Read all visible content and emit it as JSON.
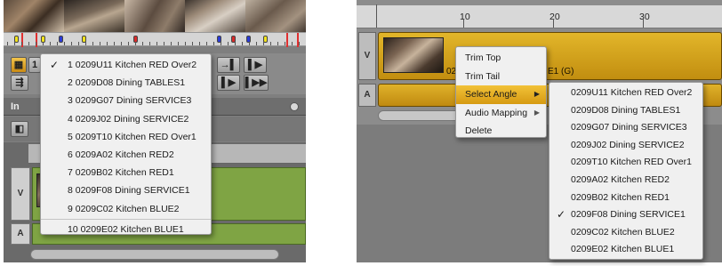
{
  "left_panel": {
    "toolbar": {
      "grid_button": "▦",
      "track_button": "1",
      "forward_button": "→▌",
      "play_in_out_button": "▌▶",
      "step_forward_button": "▌▶",
      "step_forward_fast_button": "▌▶▶",
      "audio_button": "⇶"
    },
    "tab_label": "In",
    "track_labels": {
      "video": "V",
      "audio": "A"
    },
    "angle_menu": {
      "items": [
        {
          "label": "1 0209U11 Kitchen RED Over2",
          "checked": true
        },
        {
          "label": "2 0209D08 Dining TABLES1",
          "checked": false
        },
        {
          "label": "3 0209G07 Dining SERVICE3",
          "checked": false
        },
        {
          "label": "4 0209J02 Dining SERVICE2",
          "checked": false
        },
        {
          "label": "5 0209T10 Kitchen RED Over1",
          "checked": false
        },
        {
          "label": "6 0209A02 Kitchen RED2",
          "checked": false
        },
        {
          "label": "7 0209B02 Kitchen RED1",
          "checked": false
        },
        {
          "label": "8 0209F08 Dining SERVICE1",
          "checked": false
        },
        {
          "label": "9 0209C02 Kitchen BLUE2",
          "checked": false
        }
      ],
      "extra_item": "10 0209E02 Kitchen BLUE1",
      "check_glyph": "✓"
    },
    "marker_colors": [
      "#f2e31c",
      "#f2e31c",
      "#2a3ad8",
      "#f2e31c",
      "#d82a2a",
      "#2a3ad8",
      "#d82a2a",
      "#2a3ad8",
      "#f2e31c"
    ]
  },
  "right_panel": {
    "ruler": {
      "ticks": [
        "10",
        "20",
        "30"
      ]
    },
    "track_labels": {
      "video": "V",
      "audio": "A"
    },
    "clip_label_start": "02",
    "clip_label_end": "E1 (G)",
    "context_menu": {
      "items": [
        {
          "label": "Trim Top",
          "submenu": false,
          "active": false
        },
        {
          "label": "Trim Tail",
          "submenu": false,
          "active": false
        },
        {
          "label": "Select Angle",
          "submenu": true,
          "active": true
        },
        {
          "label": "Audio Mapping",
          "submenu": true,
          "active": false
        },
        {
          "label": "Delete",
          "submenu": false,
          "active": false
        }
      ],
      "submenu_arrow": "▶"
    },
    "angle_submenu": {
      "items": [
        {
          "label": "0209U11 Kitchen RED Over2",
          "checked": false
        },
        {
          "label": "0209D08 Dining TABLES1",
          "checked": false
        },
        {
          "label": "0209G07 Dining SERVICE3",
          "checked": false
        },
        {
          "label": "0209J02 Dining SERVICE2",
          "checked": false
        },
        {
          "label": "0209T10 Kitchen RED Over1",
          "checked": false
        },
        {
          "label": "0209A02 Kitchen RED2",
          "checked": false
        },
        {
          "label": "0209B02 Kitchen RED1",
          "checked": false
        },
        {
          "label": "0209F08 Dining SERVICE1",
          "checked": true
        },
        {
          "label": "0209C02 Kitchen BLUE2",
          "checked": false
        },
        {
          "label": "0209E02 Kitchen BLUE1",
          "checked": false
        }
      ],
      "check_glyph": "✓"
    }
  },
  "colors": {
    "accent_gold": "#d69a12",
    "clip_green": "#7fa444",
    "clip_gold": "#c28e10"
  }
}
